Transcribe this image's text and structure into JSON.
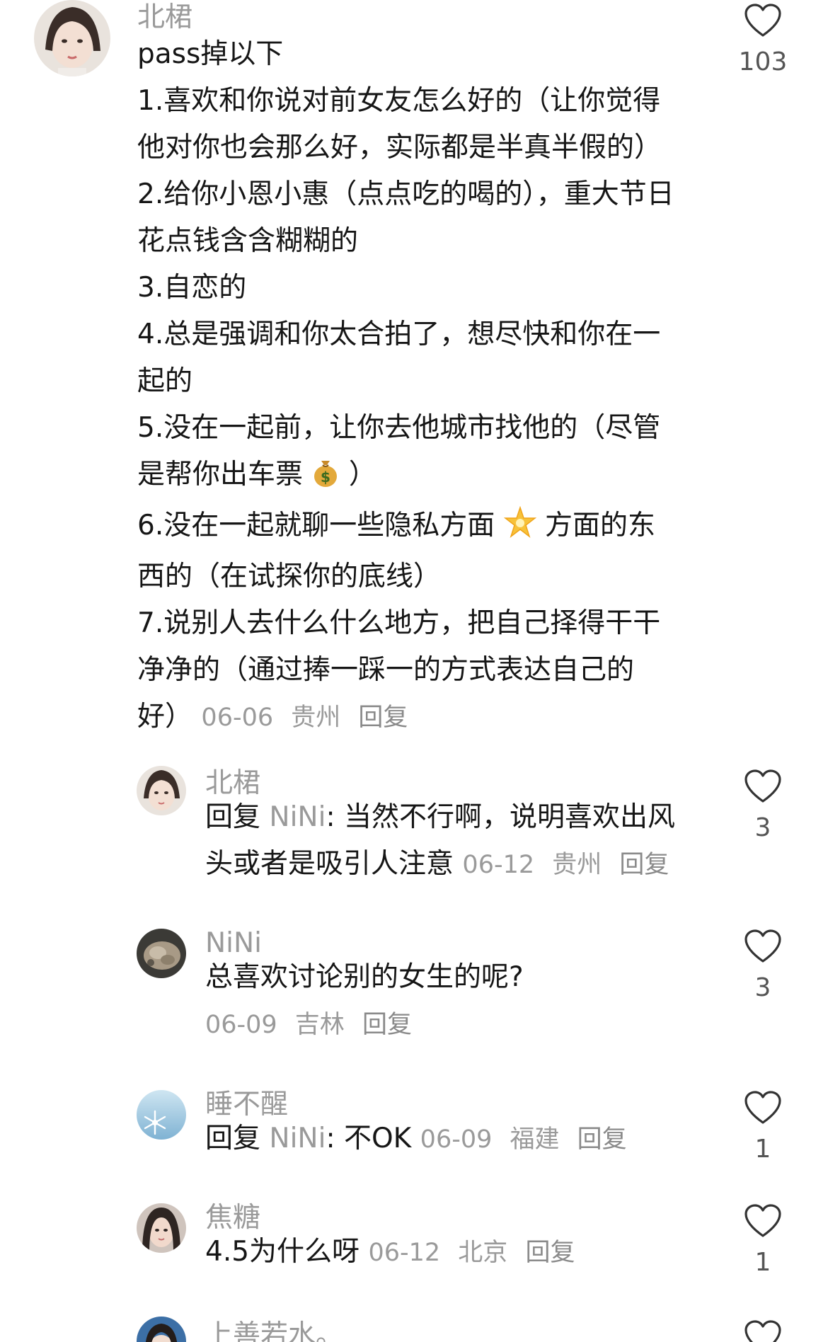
{
  "comments": [
    {
      "username": "北桾",
      "lines": [
        "pass掉以下",
        "1.喜欢和你说对前女友怎么好的（让你觉得",
        "他对你也会那么好，实际都是半真半假的）",
        "2.给你小恩小惠（点点吃的喝的），重大节日",
        "花点钱含含糊糊的",
        "3.自恋的",
        "4.总是强调和你太合拍了，想尽快和你在一",
        "起的",
        "5.没在一起前，让你去他城市找他的（尽管",
        "6.没在一起就聊一些隐私方面",
        "方面的东",
        "西的（在试探你的底线）",
        "7.说别人去什么什么地方，把自己择得干干",
        "净净的（通过捧一踩一的方式表达自己的"
      ],
      "line_5b_pre": "是帮你出车票",
      "line_5b_post": "）",
      "last_line_text": "好）",
      "date": "06-06",
      "location": "贵州",
      "reply_label": "回复",
      "likes": "103",
      "icons": [
        "money-bag-emoji",
        "star-emoji",
        "heart-icon"
      ]
    },
    {
      "username": "北桾",
      "reply_prefix": "回复",
      "mention": "NiNi",
      "text_line1": ": 当然不行啊，说明喜欢出风",
      "text_line2": "头或者是吸引人注意",
      "date": "06-12",
      "location": "贵州",
      "reply_label": "回复",
      "likes": "3"
    },
    {
      "username": "NiNi",
      "text": "总喜欢讨论别的女生的呢?",
      "date": "06-09",
      "location": "吉林",
      "reply_label": "回复",
      "likes": "3"
    },
    {
      "username": "睡不醒",
      "reply_prefix": "回复",
      "mention": "NiNi",
      "text": ": 不OK",
      "date": "06-09",
      "location": "福建",
      "reply_label": "回复",
      "likes": "1"
    },
    {
      "username": "焦糖",
      "text": "4.5为什么呀",
      "date": "06-12",
      "location": "北京",
      "reply_label": "回复",
      "likes": "1"
    },
    {
      "username": "上善若水。"
    }
  ],
  "colors": {
    "username": "#9a9a9a",
    "text": "#161616",
    "meta": "#9a9a9a",
    "heart_outline": "#333333"
  }
}
